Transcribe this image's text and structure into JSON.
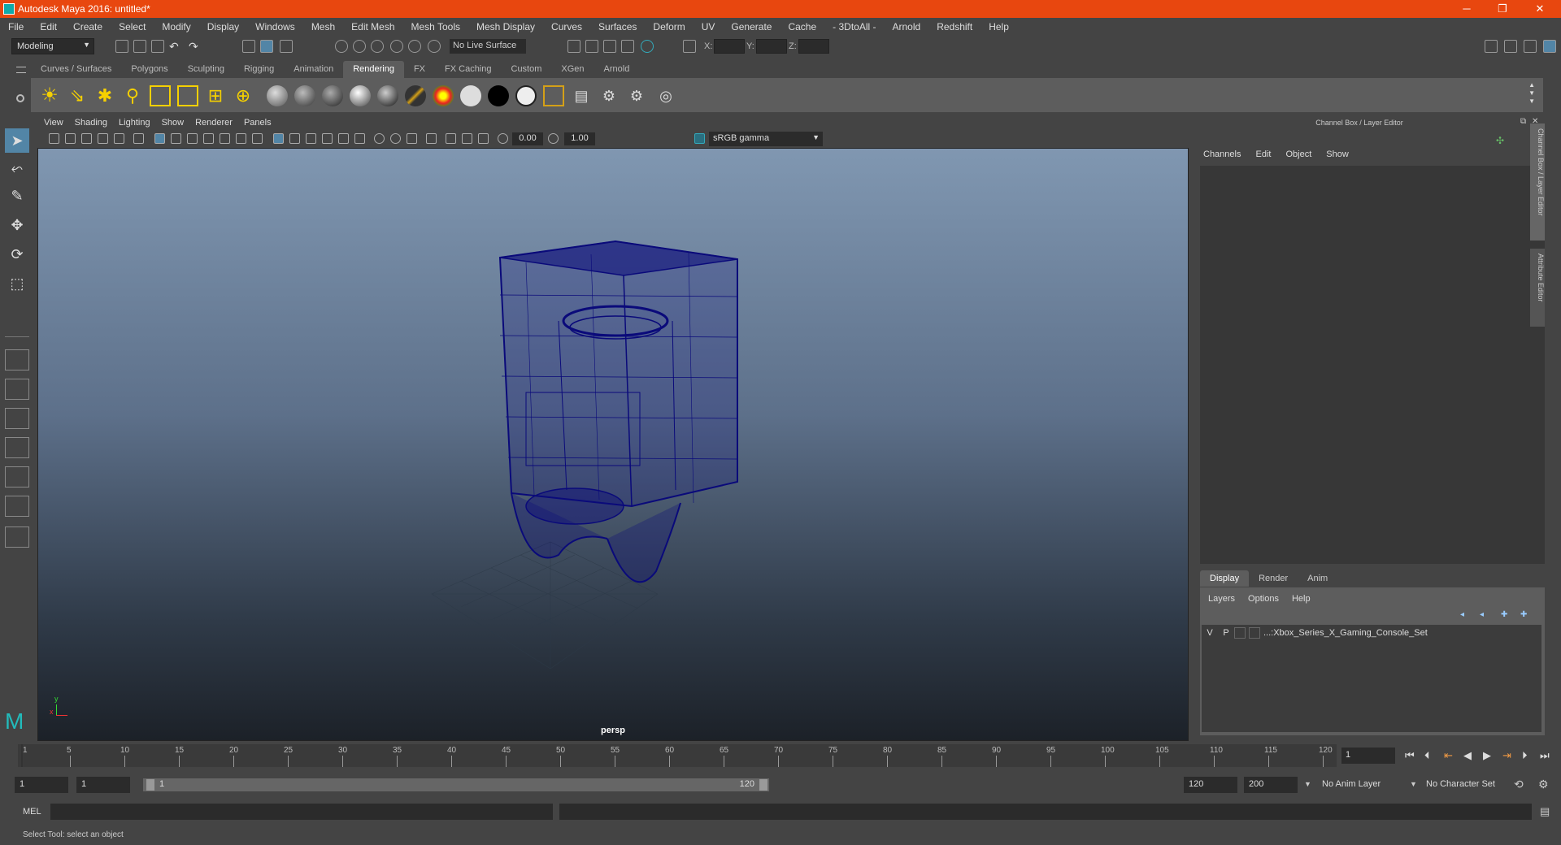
{
  "window": {
    "title": "Autodesk Maya 2016: untitled*",
    "minimize": "─",
    "maximize": "❐",
    "close": "✕"
  },
  "menubar": [
    "File",
    "Edit",
    "Create",
    "Select",
    "Modify",
    "Display",
    "Windows",
    "Mesh",
    "Edit Mesh",
    "Mesh Tools",
    "Mesh Display",
    "Curves",
    "Surfaces",
    "Deform",
    "UV",
    "Generate",
    "Cache",
    "- 3DtoAll -",
    "Arnold",
    "Redshift",
    "Help"
  ],
  "statusline": {
    "mode": "Modeling",
    "live_surface": "No Live Surface",
    "x_label": "X:",
    "y_label": "Y:",
    "z_label": "Z:"
  },
  "shelf": {
    "tabs": [
      "Curves / Surfaces",
      "Polygons",
      "Sculpting",
      "Rigging",
      "Animation",
      "Rendering",
      "FX",
      "FX Caching",
      "Custom",
      "XGen",
      "Arnold"
    ],
    "active_tab": "Rendering"
  },
  "viewport": {
    "menu": [
      "View",
      "Shading",
      "Lighting",
      "Show",
      "Renderer",
      "Panels"
    ],
    "exposure": "0.00",
    "gamma_value": "1.00",
    "color_space": "sRGB gamma",
    "camera_label": "persp",
    "axis_y": "y",
    "axis_x": "x",
    "wireframe_color": "#0a0a7a"
  },
  "channel_box": {
    "title": "Channel Box / Layer Editor",
    "menu": [
      "Channels",
      "Edit",
      "Object",
      "Show"
    ],
    "side_tabs": [
      "Channel Box / Layer Editor",
      "Attribute Editor"
    ]
  },
  "layer_editor": {
    "tabs": [
      "Display",
      "Render",
      "Anim"
    ],
    "active_tab": "Display",
    "menu": [
      "Layers",
      "Options",
      "Help"
    ],
    "layers": [
      {
        "v": "V",
        "p": "P",
        "name": "...:Xbox_Series_X_Gaming_Console_Set"
      }
    ]
  },
  "timeslider": {
    "ticks": [
      "1",
      "5",
      "10",
      "15",
      "20",
      "25",
      "30",
      "35",
      "40",
      "45",
      "50",
      "55",
      "60",
      "65",
      "70",
      "75",
      "80",
      "85",
      "90",
      "95",
      "100",
      "105",
      "110",
      "115",
      "120"
    ],
    "current_frame": "1"
  },
  "rangeslider": {
    "start": "1",
    "playback_start": "1",
    "range_start_label": "1",
    "range_end_label": "120",
    "playback_end": "120",
    "end": "200",
    "anim_layer": "No Anim Layer",
    "character_set": "No Character Set"
  },
  "commandline": {
    "label": "MEL"
  },
  "helpline": {
    "text": "Select Tool: select an object"
  }
}
